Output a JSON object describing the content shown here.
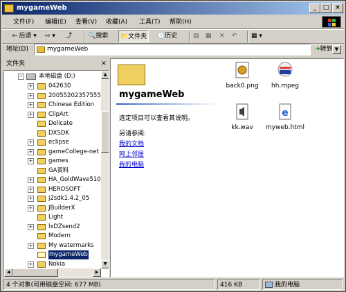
{
  "window": {
    "title": "mygameWeb",
    "min": "_",
    "max": "□",
    "close": "×"
  },
  "menu": [
    "文件(F)",
    "编辑(E)",
    "查看(V)",
    "收藏(A)",
    "工具(T)",
    "帮助(H)"
  ],
  "toolbar": {
    "back": "后退",
    "search": "搜索",
    "folders": "文件夹",
    "history": "历史"
  },
  "address": {
    "label": "地址(D)",
    "value": "mygameWeb",
    "go": "转到"
  },
  "folders_panel": {
    "title": "文件夹",
    "close": "×"
  },
  "tree": {
    "drive": "本地磁盘 (D:)",
    "items": [
      {
        "label": "042630",
        "expand": true
      },
      {
        "label": "20055202357555",
        "expand": true
      },
      {
        "label": "Chinese Edition",
        "expand": true
      },
      {
        "label": "ClipArt",
        "expand": true
      },
      {
        "label": "Delicate",
        "expand": false
      },
      {
        "label": "DXSDK",
        "expand": false
      },
      {
        "label": "eclipse",
        "expand": true
      },
      {
        "label": "gameCollege-net",
        "expand": true
      },
      {
        "label": "games",
        "expand": true
      },
      {
        "label": "GA资料",
        "expand": false
      },
      {
        "label": "HA_GoldWave510",
        "expand": true
      },
      {
        "label": "HEROSOFT",
        "expand": true
      },
      {
        "label": "j2sdk1.4.2_05",
        "expand": true
      },
      {
        "label": "JBuilderX",
        "expand": true
      },
      {
        "label": "Light",
        "expand": false
      },
      {
        "label": "lxDZsend2",
        "expand": true
      },
      {
        "label": "Modern",
        "expand": false
      },
      {
        "label": "My watermarks",
        "expand": true
      },
      {
        "label": "mygameWeb",
        "expand": false,
        "selected": true
      },
      {
        "label": "Nokia",
        "expand": true
      }
    ]
  },
  "web_view": {
    "title": "mygameWeb",
    "prompt": "选定项目可以查看其说明。",
    "see_also": "另请参阅:",
    "links": [
      "我的文档",
      "网上邻居",
      "我的电脑"
    ]
  },
  "files": [
    {
      "name": "back0.png",
      "icon": "png-image-icon"
    },
    {
      "name": "hh.mpeg",
      "icon": "mpeg-video-icon"
    },
    {
      "name": "kk.wav",
      "icon": "wav-audio-icon"
    },
    {
      "name": "myweb.html",
      "icon": "html-document-icon"
    }
  ],
  "status": {
    "objects": "4 个对象(可用磁盘空间: 677 MB)",
    "size": "416 KB",
    "location": "我的电脑"
  }
}
